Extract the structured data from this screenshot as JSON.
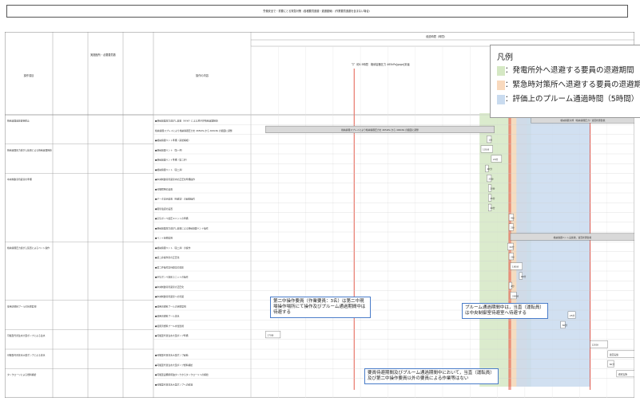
{
  "page": {
    "header": "労働安全で・重要にとる緊急対策（各種要員退避・避退動線）（作業要員退避を含まない場合）"
  },
  "legend": {
    "title": "凡例",
    "items": [
      {
        "label": "：発電所外へ退避する要員の退避期間",
        "color": "#d5e8c4"
      },
      {
        "label": "：緊急時対策所へ退避する要員の退避期間",
        "color": "#f9d9bd"
      },
      {
        "label": "：評価上のプルーム通過時間（5時間）",
        "color": "#c9dbef"
      }
    ]
  },
  "callouts": {
    "left": "第二中操作要員（作業要員：3名）は第二中現場操作場所にて操作及びプルーム通過期間中は待避する",
    "right": "プルーム通過期間中は，当直（運転員）は中央制御室待避室へ待避する",
    "bottom": "要員待避期間及びプルーム通過期間中において，当直（運転員）及び第二中操作要員以外の要員による作業等はない"
  },
  "chart_data": {
    "type": "gantt",
    "title": "",
    "timeline_label": "経過時間（時間）",
    "x_ticks": [
      "1",
      "",
      "",
      "",
      "",
      "",
      "",
      "",
      "",
      "",
      "",
      "",
      "",
      ""
    ],
    "bands": [
      {
        "name": "発電所外へ退避する要員の退避期間",
        "start": 27.5,
        "end": 31.0
      },
      {
        "name": "緊急時対策所へ退避する要員の退避期間",
        "start": 29.5,
        "end": 30.7
      },
      {
        "name": "プルーム通過時間",
        "start": 30.0,
        "end": 35.0
      }
    ],
    "milestones": [
      {
        "label": "約0.5時間　格納容器圧力 465kPa[gage]到達",
        "x": 19.0
      },
      {
        "label": "約25時間　サプレッション・プール水位",
        "x": 29.5
      },
      {
        "label": "約29時間　サプレッション・プール水位",
        "x": 29.6
      },
      {
        "label": "約31.5時間　冷却材喪失",
        "x": 35.0
      }
    ],
    "left_headers": [
      "操作項目",
      "実施箇所・必要要員数",
      "操作の内容",
      "備考"
    ],
    "rows": [
      {
        "item": "格納容器過圧破損防止",
        "op": "●格納容器圧力逃がし装置（W/W）による原子炉格納容器除熱",
        "bar": {
          "start": 31.0,
          "end": 38.0,
          "label": "格納容器冷却（格納容器圧力）適宜状態監視"
        }
      },
      {
        "item": "",
        "op": "格納容器スプレイにより格納容器圧力を 465kPa から 400kPa の範囲に調整",
        "bar": {
          "start": 13.0,
          "end": 28.5,
          "label": "格納容器スプレイにより格納容器圧力を 465kPa から 400kPa の範囲に調整"
        }
      },
      {
        "item": "",
        "op": "●格納容器ベント準備（系統構成）",
        "bar": {
          "start": 28.0,
          "end": 28.3,
          "label": "1分"
        }
      },
      {
        "item": "格納容器圧力逃がし装置による格納容器除熱",
        "op": "●格納容器ベント（第一弁）",
        "bar": {
          "start": 27.6,
          "end": 28.4,
          "label": "135分"
        }
      },
      {
        "item": "",
        "op": "●格納容器ベント準備（第二弁）",
        "bar": {
          "start": 28.3,
          "end": 29.0,
          "label": "20分"
        }
      },
      {
        "item": "",
        "op": "●格納容器ベント（第二弁）",
        "bar": {
          "start": 27.9,
          "end": 28.1,
          "label": "20分"
        }
      },
      {
        "item": "中央制御室待避室の準備",
        "op": "●中央制御室待避室内の正圧化準備操作",
        "bar": {
          "start": 28.0,
          "end": 28.3,
          "label": "20分"
        }
      },
      {
        "item": "",
        "op": "●可搬照明の設置",
        "bar": {
          "start": 28.1,
          "end": 28.3,
          "label": "10分"
        }
      },
      {
        "item": "",
        "op": "●データ表示装置（待避室）の起動操作",
        "bar": {
          "start": 28.1,
          "end": 28.3,
          "label": "15分"
        }
      },
      {
        "item": "",
        "op": "●衛星電話の設置",
        "bar": {
          "start": 28.1,
          "end": 28.3,
          "label": "10分"
        }
      },
      {
        "item": "",
        "op": "●空気ボンベ加圧ユニットの準備",
        "bar": {
          "start": 29.5,
          "end": 29.8,
          "label": "4分"
        }
      },
      {
        "item": "",
        "op": "●格納容器圧力逃がし装置による格納容器ベント操作",
        "bar": {
          "start": 29.5,
          "end": 29.8,
          "label": "2分"
        }
      },
      {
        "item": "",
        "op": "●ベント状態監視",
        "bar": {
          "start": 29.6,
          "end": 38.0,
          "label": "格納容器ベント実施後，適宜状態監視"
        }
      },
      {
        "item": "格納容器圧力逃がし装置によるベント操作",
        "op": "●格納容器ベント（第二弁）の操作",
        "bar": {
          "start": 29.4,
          "end": 29.8,
          "label": "30分"
        }
      },
      {
        "item": "",
        "op": "●第二弁操作室の正圧化",
        "bar": {
          "start": 29.5,
          "end": 29.8,
          "label": "2分"
        }
      },
      {
        "item": "",
        "op": "●第二弁操作室待避室の加圧",
        "bar": {
          "start": 29.6,
          "end": 30.4,
          "label": "180分"
        }
      },
      {
        "item": "",
        "op": "●空気ボンベ加圧ユニットの操作",
        "bar": {
          "start": 30.2,
          "end": 30.4,
          "label": "60分"
        }
      },
      {
        "item": "",
        "op": "●中央制御室待避室の正圧化",
        "bar": {
          "start": 29.5,
          "end": 29.7,
          "label": "4分"
        }
      },
      {
        "item": "",
        "op": "●中央制御室待避室への待避",
        "bar": {
          "start": 29.6,
          "end": 30.0,
          "label": "300分"
        }
      },
      {
        "item": "使用済燃料プールの状態監視",
        "op": "●使用済燃料プールの状態監視",
        "bar": null
      },
      {
        "item": "",
        "op": "●使用済燃料プール注水",
        "bar": {
          "start": 33.5,
          "end": 34.0,
          "label": "25分"
        }
      },
      {
        "item": "",
        "op": "●使用済燃料プール水位監視",
        "bar": {
          "start": 33.0,
          "end": 33.3,
          "label": "60分"
        }
      },
      {
        "item": "可搬型代替注水大型ポンプによる注水",
        "op": "●可搬型代替注水大型ポンプ準備",
        "bar": {
          "start": 13.0,
          "end": 14.0,
          "label": "170分"
        }
      },
      {
        "item": "",
        "op": "",
        "bar": {
          "start": 35.0,
          "end": 36.2,
          "label": "120分"
        }
      },
      {
        "item": "可搬型代替注水大型ポンプによる注水",
        "op": "●可搬型代替注水大型ポンプ起動",
        "bar": {
          "start": 36.2,
          "end": 38.0,
          "label": "適宜実施"
        }
      },
      {
        "item": "",
        "op": "●可搬型代替注水大型ポンプ燃料補給",
        "bar": {
          "start": 36.2,
          "end": 36.6,
          "label": "60分"
        }
      },
      {
        "item": "タンクローリによる燃料補給",
        "op": "●可搬型設備用軽油タンクからタンクローリへの補給",
        "bar": {
          "start": 36.8,
          "end": 38.0,
          "label": "適宜実施"
        }
      },
      {
        "item": "",
        "op": "●可搬型代替注水大型ポンプへの給油",
        "bar": null
      }
    ]
  }
}
